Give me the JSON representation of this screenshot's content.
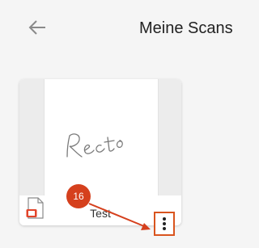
{
  "header": {
    "back_icon": "arrow-left-icon",
    "title": "Meine Scans"
  },
  "scan": {
    "name": "Test",
    "preview_text": "Recto",
    "file_icon": "pdf-document-icon",
    "menu_icon": "more-vertical-icon"
  },
  "annotation": {
    "step_number": "16",
    "color": "#d5401d"
  },
  "colors": {
    "background": "#f5f5f5",
    "card": "#ffffff",
    "accent": "#d5401d",
    "text": "#222222"
  }
}
